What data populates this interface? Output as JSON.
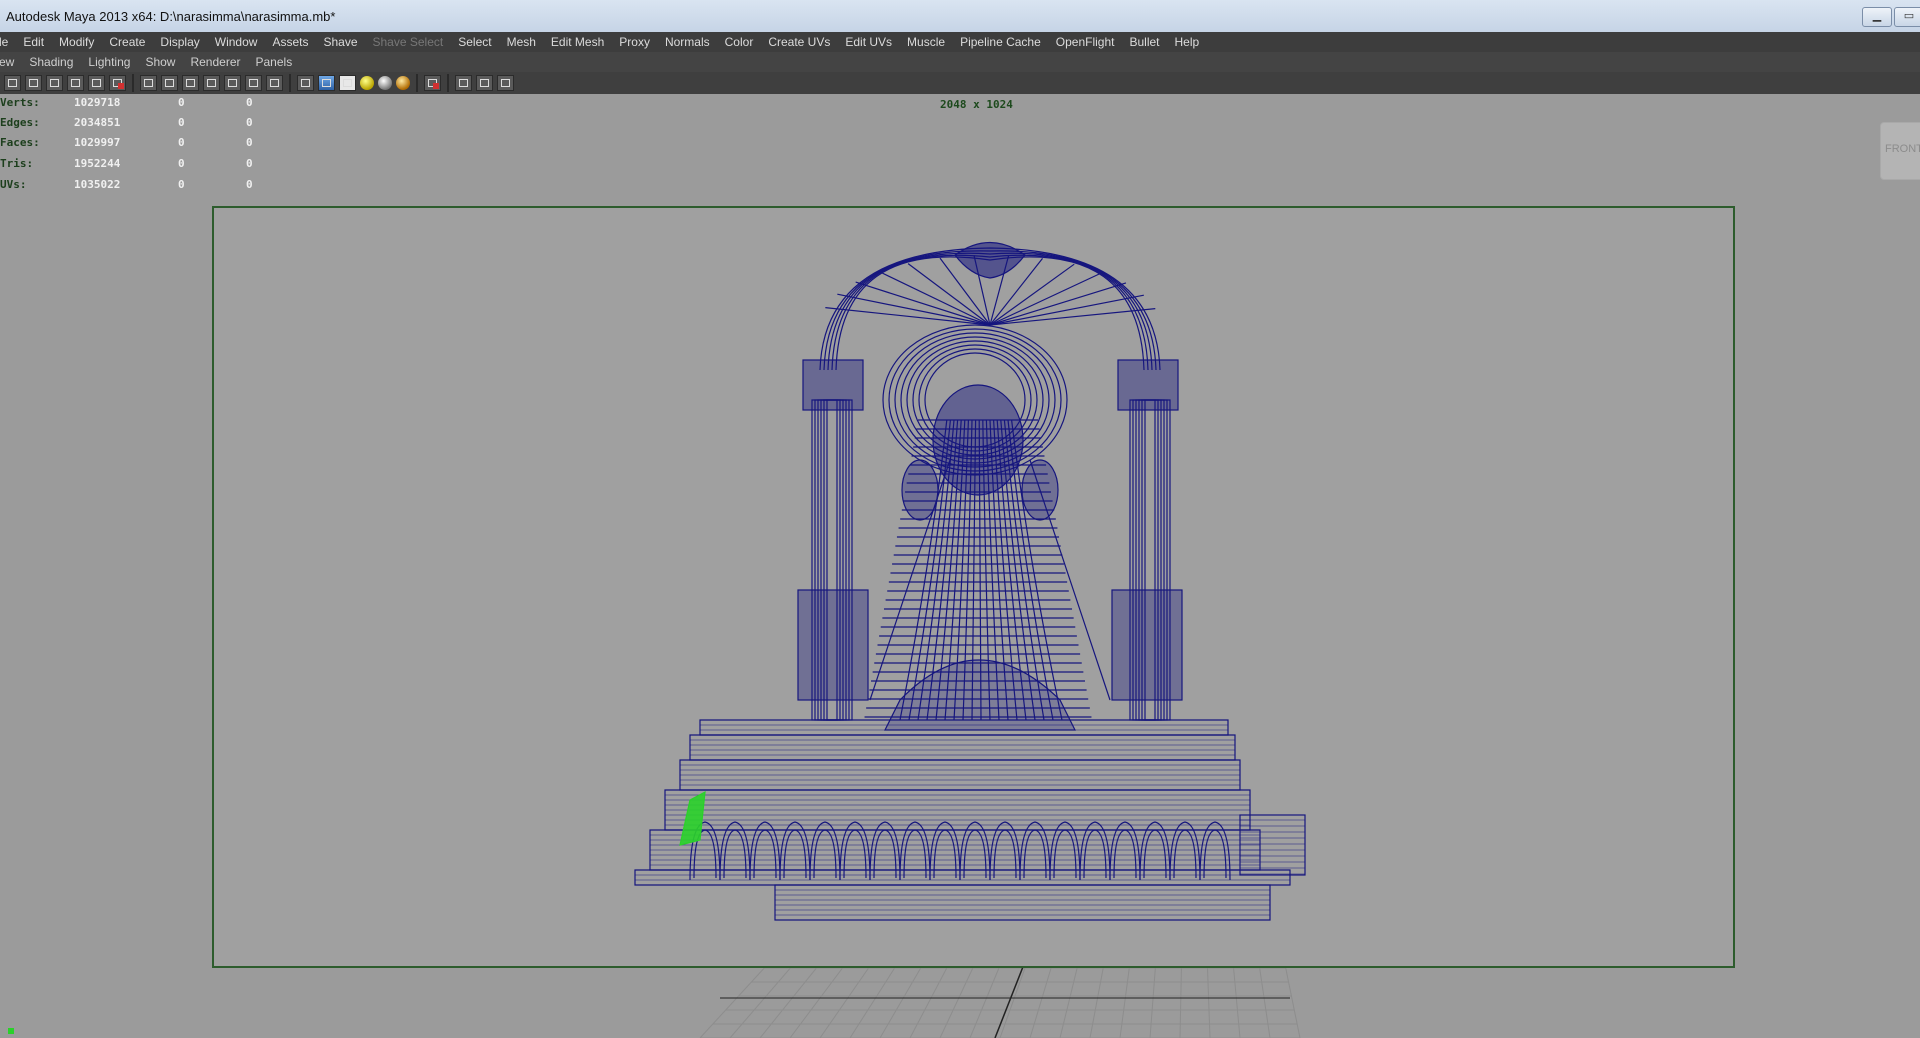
{
  "window": {
    "title": "Autodesk Maya 2013 x64: D:\\narasimma\\narasimma.mb*"
  },
  "main_menu": [
    "le",
    "Edit",
    "Modify",
    "Create",
    "Display",
    "Window",
    "Assets",
    "Shave",
    "Shave Select",
    "Select",
    "Mesh",
    "Edit Mesh",
    "Proxy",
    "Normals",
    "Color",
    "Create UVs",
    "Edit UVs",
    "Muscle",
    "Pipeline Cache",
    "OpenFlight",
    "Bullet",
    "Help"
  ],
  "panel_menu": [
    "ew",
    "Shading",
    "Lighting",
    "Show",
    "Renderer",
    "Panels"
  ],
  "hud": {
    "rows": [
      {
        "label": "Verts:",
        "v1": "1029718",
        "v2": "0",
        "v3": "0"
      },
      {
        "label": "Edges:",
        "v1": "2034851",
        "v2": "0",
        "v3": "0"
      },
      {
        "label": "Faces:",
        "v1": "1029997",
        "v2": "0",
        "v3": "0"
      },
      {
        "label": "Tris:",
        "v1": "1952244",
        "v2": "0",
        "v3": "0"
      },
      {
        "label": "UVs:",
        "v1": "1035022",
        "v2": "0",
        "v3": "0"
      }
    ],
    "resolution": "2048 x 1024"
  },
  "view_cube": {
    "label": "FRONT"
  },
  "colors": {
    "wireframe": "#16167e",
    "hud_label": "#1d3f1d",
    "selection": "#2ad12a"
  }
}
